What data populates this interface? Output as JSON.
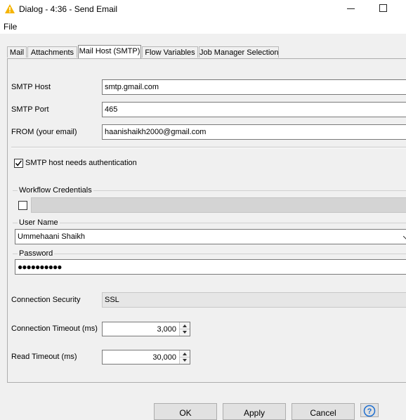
{
  "window": {
    "title": "Dialog - 4:36 - Send Email",
    "icon": "warning-triangle-icon",
    "accent": "#f5b400"
  },
  "menu": {
    "file": "File"
  },
  "tabs": [
    {
      "label": "Mail"
    },
    {
      "label": "Attachments"
    },
    {
      "label": "Mail Host (SMTP)",
      "active": true
    },
    {
      "label": "Flow Variables"
    },
    {
      "label": "Job Manager Selection"
    }
  ],
  "form": {
    "smtp_host_label": "SMTP Host",
    "smtp_host_value": "smtp.gmail.com",
    "smtp_port_label": "SMTP Port",
    "smtp_port_value": "465",
    "from_label": "FROM (your email)",
    "from_value": "haanishaikh2000@gmail.com",
    "auth_label": "SMTP host needs authentication",
    "auth_checked": true,
    "workflow_credentials_label": "Workflow Credentials",
    "workflow_credentials_checked": false,
    "username_group_label": "User Name",
    "username_value": "Ummehaani Shaikh",
    "password_group_label": "Password",
    "password_value": "●●●●●●●●●●",
    "connection_security_label": "Connection Security",
    "connection_security_value": "SSL",
    "connection_timeout_label": "Connection Timeout (ms)",
    "connection_timeout_value": "3,000",
    "read_timeout_label": "Read Timeout (ms)",
    "read_timeout_value": "30,000"
  },
  "buttons": {
    "ok": "OK",
    "apply": "Apply",
    "cancel": "Cancel",
    "help_icon": "help-icon"
  }
}
